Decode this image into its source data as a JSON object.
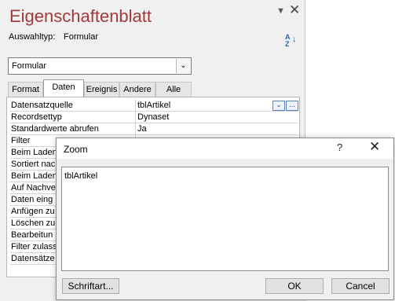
{
  "property_sheet": {
    "title": "Eigenschaftenblatt",
    "selection_type_label": "Auswahltyp:",
    "selection_type_value": "Formular",
    "sort_icon": "sort-az-icon",
    "object_combo": "Formular",
    "tabs": [
      {
        "label": "Format"
      },
      {
        "label": "Daten"
      },
      {
        "label": "Ereignis"
      },
      {
        "label": "Andere"
      },
      {
        "label": "Alle"
      }
    ],
    "active_tab": "Daten",
    "rows": [
      {
        "name": "Datensatzquelle",
        "value": "tblArtikel"
      },
      {
        "name": "Recordsettyp",
        "value": "Dynaset"
      },
      {
        "name": "Standardwerte abrufen",
        "value": "Ja"
      },
      {
        "name": "Filter",
        "value": ""
      },
      {
        "name": "Beim Laden",
        "value": ""
      },
      {
        "name": "Sortiert nac",
        "value": ""
      },
      {
        "name": "Beim Laden",
        "value": ""
      },
      {
        "name": "Auf Nachve",
        "value": ""
      },
      {
        "name": "Daten eing",
        "value": ""
      },
      {
        "name": "Anfügen zu",
        "value": ""
      },
      {
        "name": "Löschen zu",
        "value": ""
      },
      {
        "name": "Bearbeitun",
        "value": ""
      },
      {
        "name": "Filter zulass",
        "value": ""
      },
      {
        "name": "Datensätze",
        "value": ""
      }
    ],
    "builder_button": "..."
  },
  "zoom_dialog": {
    "title": "Zoom",
    "help": "?",
    "text": "tblArtikel",
    "font_button": "Schriftart...",
    "ok_button": "OK",
    "cancel_button": "Cancel"
  }
}
